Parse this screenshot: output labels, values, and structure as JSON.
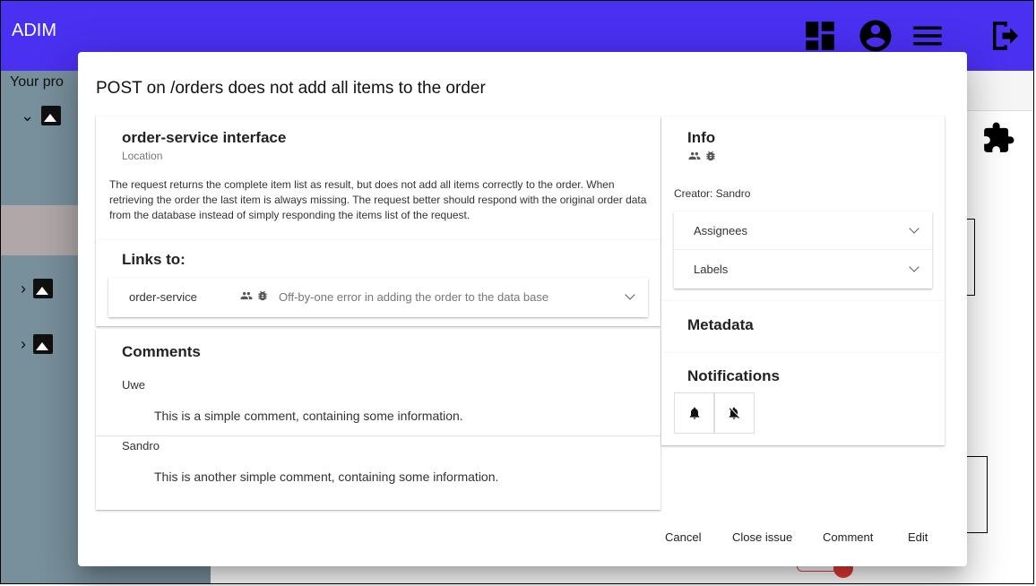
{
  "app": {
    "title": "ADIM"
  },
  "toolbar_icons": [
    "dashboard-icon",
    "account-circle-icon",
    "menu-icon",
    "logout-icon"
  ],
  "sidebar": {
    "label": "Your pro"
  },
  "dialog": {
    "title": "POST on /orders does not add all items to the order",
    "location": {
      "name": "order-service interface",
      "type": "Location",
      "description": "The request returns the complete item list as result, but does not add all items correctly to the order. When retrieving the order the last item is always missing. The request better should respond with the original order data from the database instead of simply responding the items list of the request."
    },
    "links": {
      "heading": "Links to:",
      "items": [
        {
          "component": "order-service",
          "issue": "Off-by-one error in adding the order to the data base"
        }
      ]
    },
    "comments": {
      "heading": "Comments",
      "items": [
        {
          "author": "Uwe",
          "text": "This is a simple comment, containing some information."
        },
        {
          "author": "Sandro",
          "text": "This is another simple comment, containing some information."
        }
      ]
    },
    "info": {
      "heading": "Info",
      "creator": "Creator: Sandro",
      "assignees_label": "Assignees",
      "labels_label": "Labels"
    },
    "metadata": {
      "heading": "Metadata"
    },
    "notifications": {
      "heading": "Notifications"
    },
    "actions": {
      "cancel": "Cancel",
      "close_issue": "Close issue",
      "comment": "Comment",
      "edit": "Edit"
    }
  },
  "colors": {
    "topbar": "#4a30f0",
    "sidebar": "#78909c"
  }
}
